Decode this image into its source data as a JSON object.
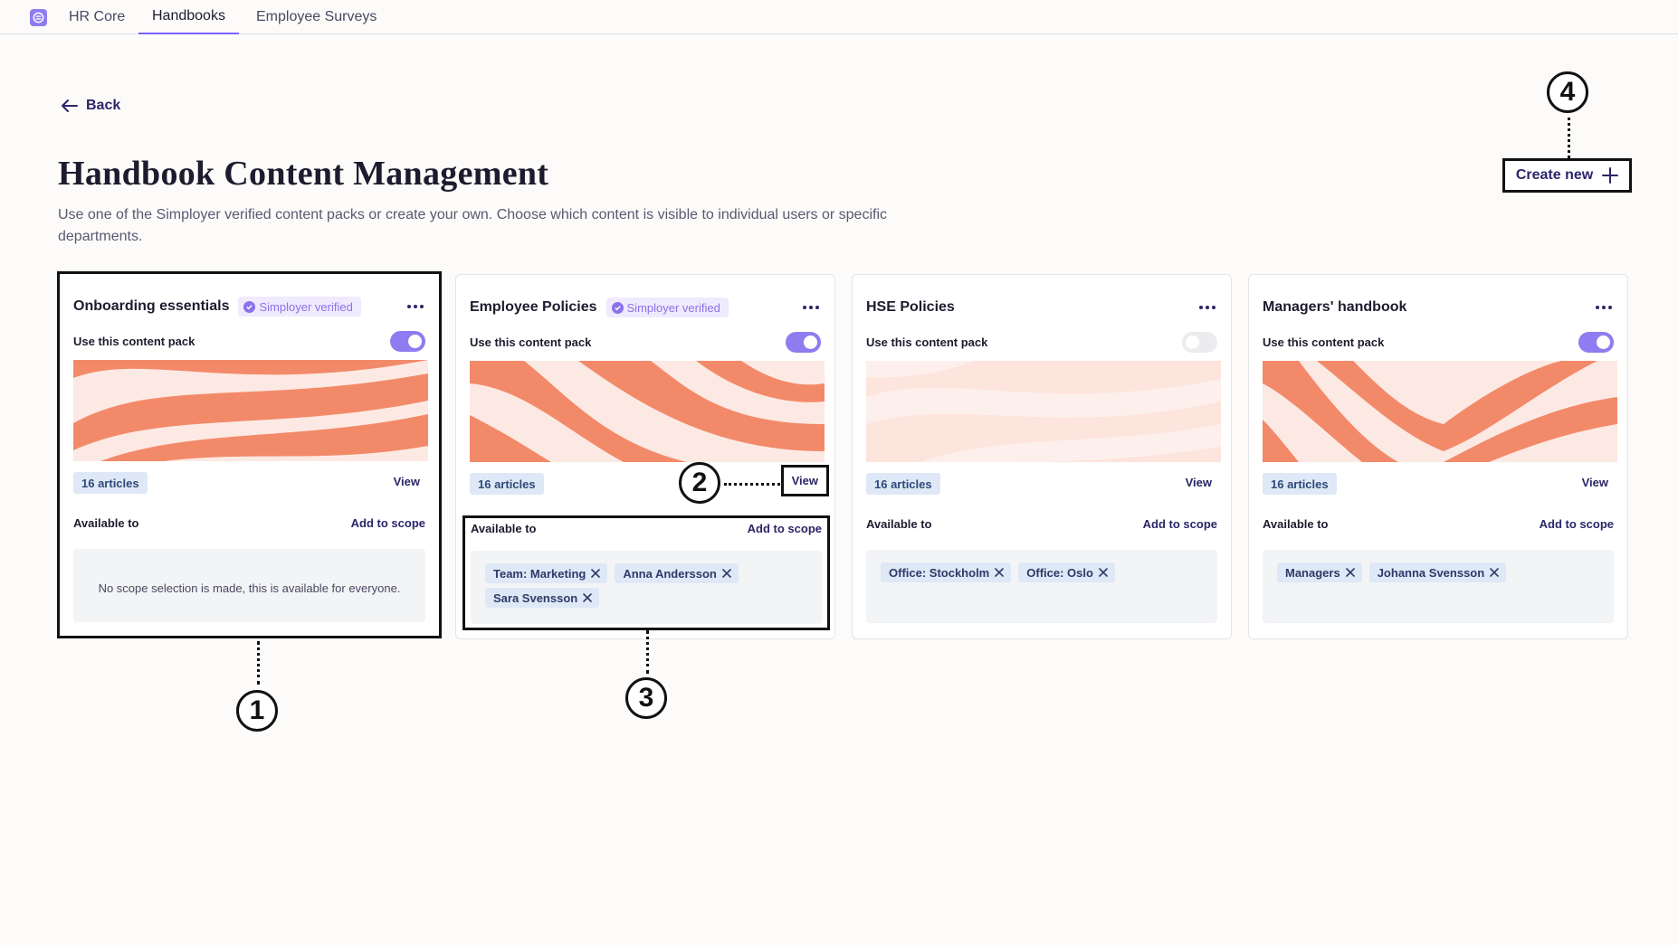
{
  "nav": {
    "tabs": [
      {
        "label": "HR Core"
      },
      {
        "label": "Handbooks"
      },
      {
        "label": "Employee Surveys"
      }
    ]
  },
  "header": {
    "back_label": "Back",
    "title": "Handbook Content Management",
    "description": "Use one of the Simployer verified content packs or create your own. Choose which content is visible to individual users or specific departments.",
    "create_label": "Create new"
  },
  "colors": {
    "accent": "#8e7cf0",
    "banner_orange": "#f28a6a",
    "banner_light": "#fde9e3",
    "chip_bg": "#dfe8f6"
  },
  "cards": [
    {
      "title": "Onboarding essentials",
      "verified_label": "Simployer verified",
      "use_label": "Use this content pack",
      "enabled": true,
      "articles": "16 articles",
      "view_label": "View",
      "available_label": "Available to",
      "add_scope_label": "Add to scope",
      "empty_message": "No scope selection is made, this is available for everyone.",
      "chips": []
    },
    {
      "title": "Employee Policies",
      "verified_label": "Simployer verified",
      "use_label": "Use this content pack",
      "enabled": true,
      "articles": "16 articles",
      "view_label": "View",
      "available_label": "Available to",
      "add_scope_label": "Add to scope",
      "chips": [
        "Team: Marketing",
        "Anna Andersson",
        "Sara Svensson"
      ]
    },
    {
      "title": "HSE Policies",
      "use_label": "Use this content pack",
      "enabled": false,
      "articles": "16 articles",
      "view_label": "View",
      "available_label": "Available to",
      "add_scope_label": "Add to scope",
      "chips": [
        "Office: Stockholm",
        "Office: Oslo"
      ]
    },
    {
      "title": "Managers' handbook",
      "use_label": "Use this content pack",
      "enabled": true,
      "articles": "16 articles",
      "view_label": "View",
      "available_label": "Available to",
      "add_scope_label": "Add to scope",
      "chips": [
        "Managers",
        "Johanna Svensson"
      ]
    }
  ],
  "callouts": [
    "1",
    "2",
    "3",
    "4"
  ]
}
